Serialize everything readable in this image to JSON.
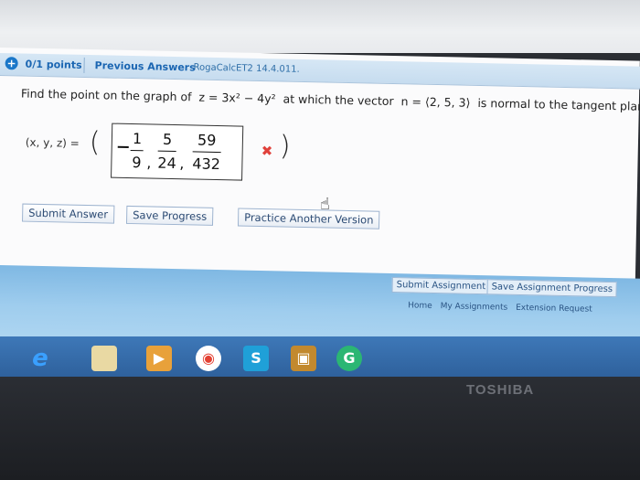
{
  "header": {
    "points": "0/1 points",
    "previous_answers": "Previous Answers",
    "course_code": "RogaCalcET2 14.4.011."
  },
  "question": {
    "text_before": "Find the point on the graph of",
    "equation": "z = 3x² − 4y²",
    "text_middle": "at which the vector",
    "vector": "n = ⟨2, 5, 3⟩",
    "text_after": "is normal to the tangent plane."
  },
  "answer": {
    "label": "(x, y, z) =",
    "open_paren": "(",
    "close_paren": ")",
    "fractions": [
      {
        "num": "1",
        "den": "9",
        "sign": "-"
      },
      {
        "num": "5",
        "den": "24"
      },
      {
        "num": "59",
        "den": "432"
      }
    ],
    "status": "✖"
  },
  "buttons": {
    "submit_answer": "Submit Answer",
    "save_progress": "Save Progress",
    "practice_another": "Practice Another Version"
  },
  "assignment_buttons": {
    "submit_assignment": "Submit Assignment",
    "save_assignment_progress": "Save Assignment Progress"
  },
  "footer_links": [
    "Home",
    "My Assignments",
    "Extension Request"
  ],
  "taskbar_icons": [
    "ie-icon",
    "file-explorer-icon",
    "media-player-icon",
    "chrome-icon",
    "skype-icon",
    "video-icon",
    "grammarly-icon"
  ],
  "brand": "TOSHIBA",
  "colors": {
    "link_blue": "#1b66b2",
    "error_red": "#e0413b",
    "band_blue": "#9fcdee"
  }
}
